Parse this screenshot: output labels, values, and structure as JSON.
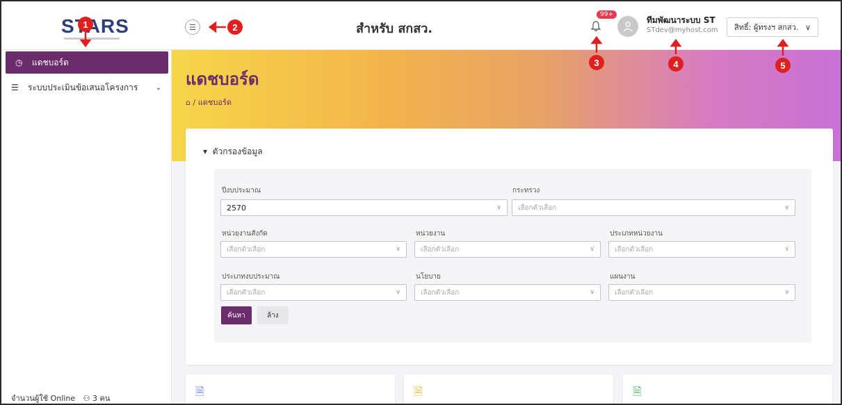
{
  "header": {
    "logo": "STARS",
    "title": "สำหรับ สกสว.",
    "notification_badge": "99+",
    "user_name": "ทีมพัฒนาระบบ ST",
    "user_email": "STdev@myhost.com",
    "role_label": "สิทธิ์: ผู้ทรงฯ สกสว.",
    "icons": [
      "menu-toggle-icon",
      "bell-icon",
      "avatar-icon",
      "chevron-down-icon"
    ]
  },
  "sidebar": {
    "items": [
      {
        "label": "แดชบอร์ด",
        "icon": "dashboard-icon",
        "active": true
      },
      {
        "label": "ระบบประเมินข้อเสนอโครงการ",
        "icon": "list-icon",
        "active": false
      }
    ],
    "online_label": "จำนวนผู้ใช้ Online",
    "online_count": "3 คน"
  },
  "banner": {
    "title": "แดชบอร์ด",
    "breadcrumb": "แดชบอร์ด"
  },
  "filter": {
    "heading": "ตัวกรองข้อมูล",
    "fields": {
      "fiscal_year": {
        "label": "ปีงบประมาณ",
        "value": "2570"
      },
      "ministry": {
        "label": "กระทรวง",
        "placeholder": "เลือกตัวเลือก"
      },
      "agency_group": {
        "label": "หน่วยงานสังกัด",
        "placeholder": "เลือกตัวเลือก"
      },
      "agency": {
        "label": "หน่วยงาน",
        "placeholder": "เลือกตัวเลือก"
      },
      "agency_type": {
        "label": "ประเภทหน่วยงาน",
        "placeholder": "เลือกตัวเลือก"
      },
      "budget_type": {
        "label": "ประเภทงบประมาณ",
        "placeholder": "เลือกตัวเลือก"
      },
      "policy": {
        "label": "นโยบาย",
        "placeholder": "เลือกตัวเลือก"
      },
      "plan": {
        "label": "แผนงาน",
        "placeholder": "เลือกตัวเลือก"
      }
    },
    "search_label": "ค้นหา",
    "clear_label": "ล้าง"
  },
  "markers": [
    "1",
    "2",
    "3",
    "4",
    "5"
  ],
  "colors": {
    "brand": "#6b2c6b",
    "badge": "#e53b4f",
    "marker": "#e0201f"
  }
}
